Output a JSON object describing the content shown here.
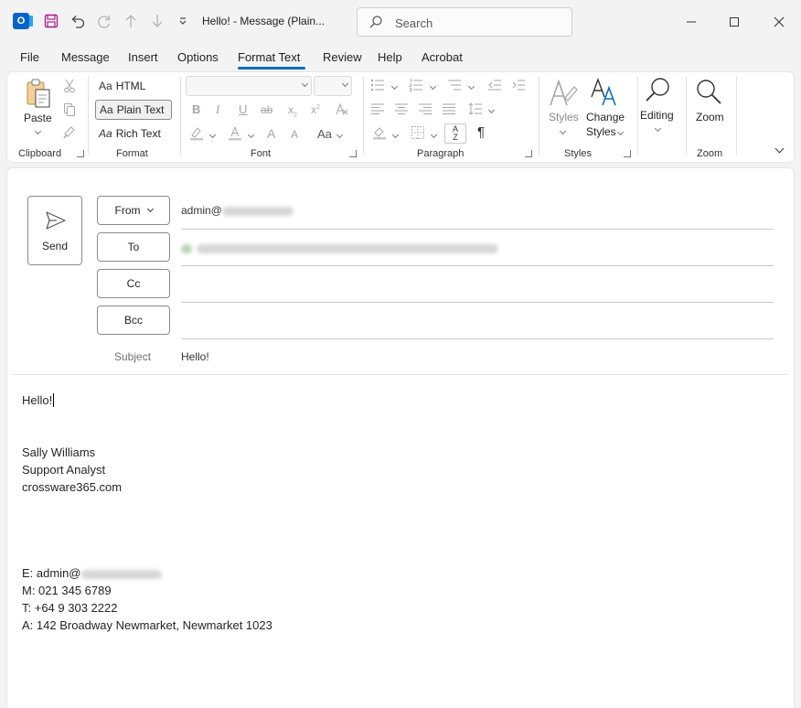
{
  "titlebar": {
    "app_icon_letter": "O",
    "window_title": "Hello!  -  Message (Plain...",
    "search_placeholder": "Search",
    "icons": [
      "save-icon",
      "undo-icon",
      "redo-icon",
      "up-arrow-icon",
      "down-arrow-icon",
      "customize-qat-icon",
      "minimize-icon",
      "maximize-icon",
      "close-icon"
    ]
  },
  "menu": {
    "items": [
      "File",
      "Message",
      "Insert",
      "Options",
      "Format Text",
      "Review",
      "Help",
      "Acrobat"
    ],
    "active": "Format Text"
  },
  "ribbon": {
    "clipboard": {
      "paste_label": "Paste",
      "group_label": "Clipboard"
    },
    "format": {
      "html_label": "HTML",
      "plain_label": "Plain Text",
      "rich_label": "Rich Text",
      "aa": "Aa",
      "group_label": "Format"
    },
    "font": {
      "group_label": "Font",
      "bold": "B",
      "italic": "I",
      "underline": "U",
      "strike": "ab",
      "sub": "x",
      "sup": "x",
      "sub2": "2",
      "sup2": "2",
      "grow": "A",
      "shrink": "A",
      "case": "Aa"
    },
    "paragraph": {
      "group_label": "Paragraph",
      "pilcrow": "¶",
      "sort_a": "A",
      "sort_z": "Z"
    },
    "styles": {
      "styles_label": "Styles",
      "change_label_1": "Change",
      "change_label_2": "Styles",
      "group_label": "Styles"
    },
    "editing": {
      "label": "Editing"
    },
    "zoom": {
      "label": "Zoom",
      "group_label": "Zoom"
    }
  },
  "compose": {
    "send_label": "Send",
    "from_label": "From",
    "to_label": "To",
    "cc_label": "Cc",
    "bcc_label": "Bcc",
    "subject_label": "Subject",
    "from_value": "admin@",
    "subject_value": "Hello!",
    "body": {
      "greeting": "Hello!",
      "name": "Sally Williams",
      "role": "Support Analyst",
      "website": "crossware365.com",
      "email_prefix": "E: admin@",
      "mobile": "M: 021 345 6789",
      "phone": "T:  +64 9 303 2222",
      "address": "A:  142 Broadway Newmarket, Newmarket 1023"
    }
  }
}
